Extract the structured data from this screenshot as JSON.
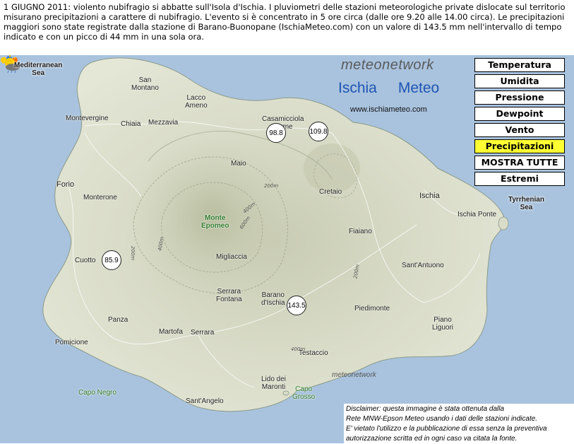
{
  "intro": {
    "line1": "1 GIUGNO 2011: violento nubifragio si abbatte sull'Isola d'Ischia. I pluviometri delle stazioni meteorologiche private dislocate sul territorio",
    "line2": "misurano precipitazioni a carattere di nubifragio. L'evento si è concentrato in 5 ore circa (dalle ore 9.20 alle 14.00 circa). Le precipitazioni",
    "line3": "maggiori sono state registrate dalla stazione di Barano-Buonopane (IschiaMeteo.com) con un valore di 143.5 mm nell'intervallo di tempo",
    "line4": "indicato e con un picco di 44 mm in una sola ora."
  },
  "branding": {
    "meteonetwork": "meteonetwork",
    "ischia_left": "Ischia",
    "ischia_right": "Meteo",
    "url": "www.ischiameteo.com",
    "watermark": "meteonetwork"
  },
  "menu": {
    "temperatura": "Temperatura",
    "umidita": "Umidita",
    "pressione": "Pressione",
    "dewpoint": "Dewpoint",
    "vento": "Vento",
    "precipitazioni": "Precipitazioni",
    "mostra_tutte": "MOSTRA TUTTE",
    "estremi": "Estremi",
    "active": "Precipitazioni",
    "active_color": "#ffff33"
  },
  "seas": {
    "mediterranean_1": "Mediterranean",
    "mediterranean_2": "Sea",
    "tyrrhenian_1": "Tyrrhenian",
    "tyrrhenian_2": "Sea"
  },
  "places": {
    "san_montano_1": "San",
    "san_montano_2": "Montano",
    "lacco_1": "Lacco",
    "lacco_2": "Ameno",
    "casamicciola_1": "Casamicciola",
    "casamicciola_2": "Terme",
    "montevergine": "Montevergine",
    "chiaia": "Chiaia",
    "mezzavia": "Mezzavia",
    "maio": "Maio",
    "forio": "Forio",
    "monterone": "Monterone",
    "cretaio": "Cretaio",
    "ischia": "Ischia",
    "ischia_ponte": "Ischia Ponte",
    "monte_epomeo_1": "Monte",
    "monte_epomeo_2": "Epomeo",
    "fiaiano": "Fiaiano",
    "cuotto": "Cuotto",
    "migliaccia": "Migliaccia",
    "santantuono": "Sant'Antuono",
    "serrara_fontana_1": "Serrara",
    "serrara_fontana_2": "Fontana",
    "barano_1": "Barano",
    "barano_2": "d'Ischia",
    "piedimonte": "Piedimonte",
    "panza": "Panza",
    "piano_liguori_1": "Piano",
    "piano_liguori_2": "Liguori",
    "martofa": "Martofa",
    "serrara": "Serrara",
    "pomicione": "Pomicione",
    "testaccio": "Testaccio",
    "capo_negro": "Capo Negro",
    "lido_maronti_1": "Lido dei",
    "lido_maronti_2": "Maronti",
    "capo_grosso_1": "Capo",
    "capo_grosso_2": "Grosso",
    "santangelo": "Sant'Angelo"
  },
  "contours": {
    "c1": "200m",
    "c2": "400m",
    "c3": "600m",
    "c4": "200m",
    "c5": "400m",
    "c6": "200m",
    "c7": "400m"
  },
  "stations": {
    "lacco_val": "98.8",
    "casamicciola_val": "109.8",
    "cuotto_val": "85.9",
    "barano_val": "143.5"
  },
  "disclaimer": {
    "line1": "Disclaimer: questa immagine è stata ottenuta dalla",
    "line2": "Rete MNW-Epson Meteo usando i dati delle stazioni indicate.",
    "line3": "E' vietato l'utilizzo e la pubblicazione di essa senza la preventiva",
    "line4": "autorizzazione scritta ed in ogni caso va citata la fonte."
  },
  "colors": {
    "sea": "#a9c3de",
    "land": "#d8dbc6",
    "brand_blue": "#1e54b4"
  }
}
